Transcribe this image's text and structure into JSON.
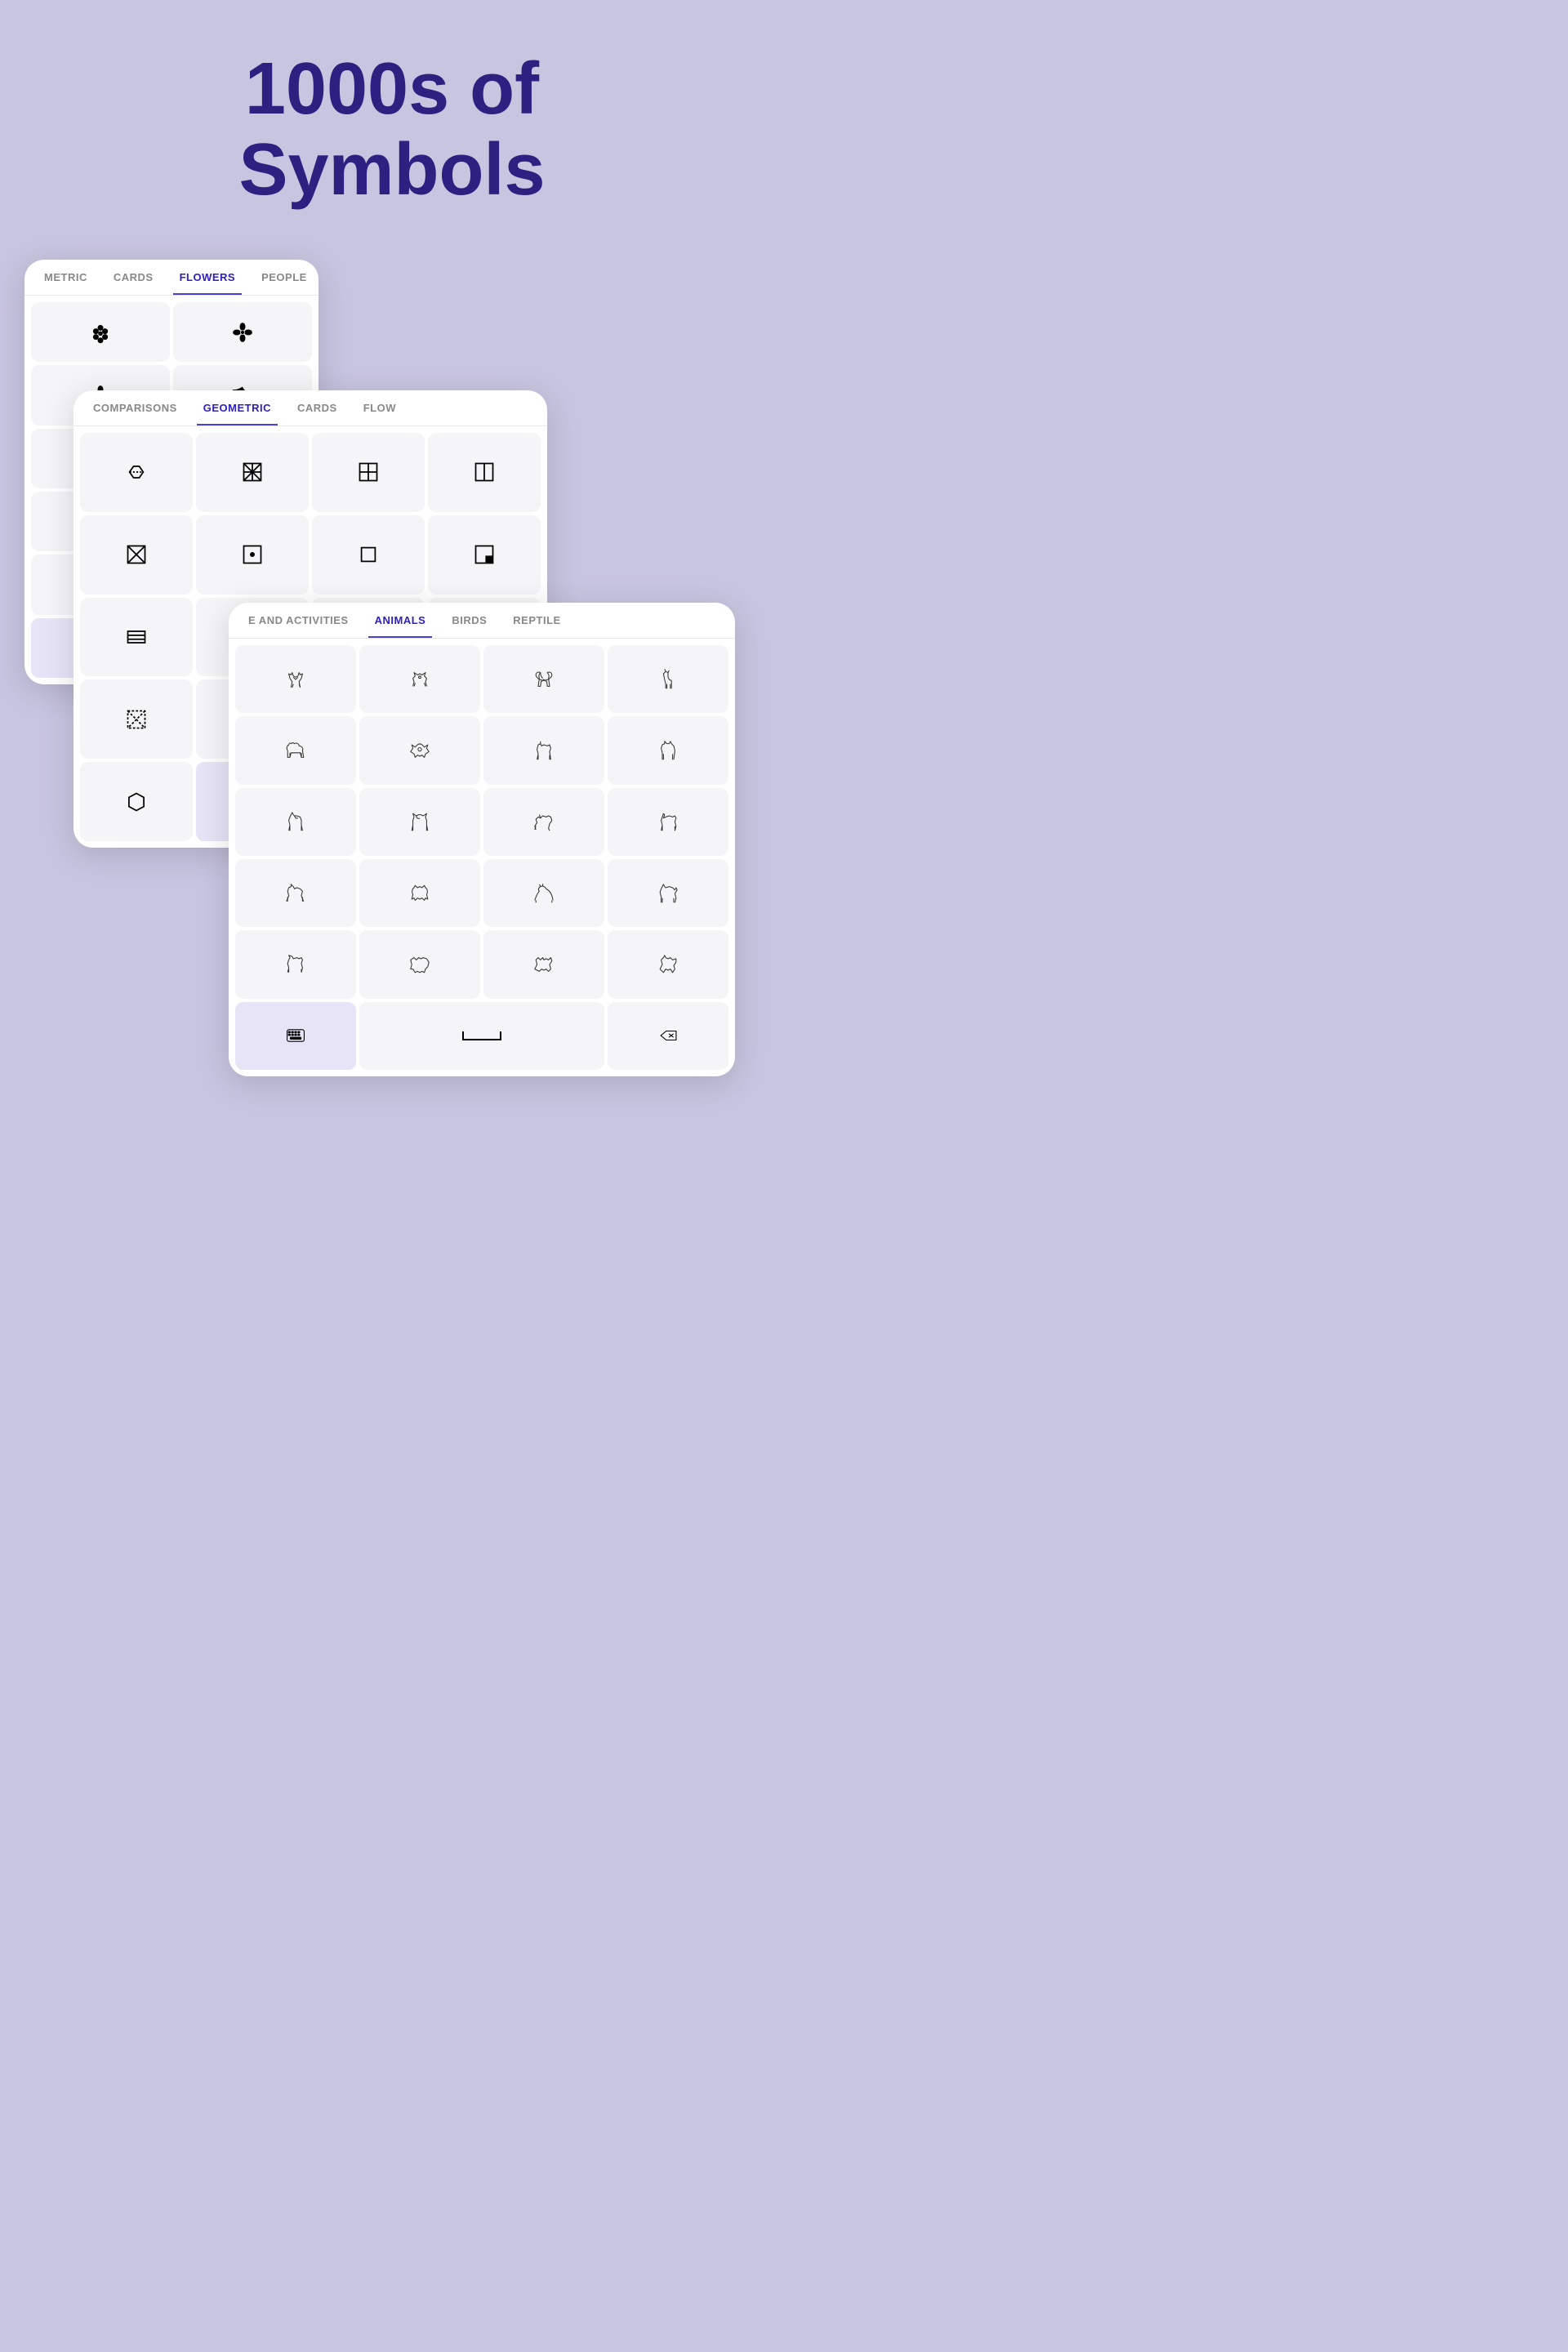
{
  "title": {
    "line1": "1000s of",
    "line2": "Symbols"
  },
  "panel1": {
    "tabs": [
      {
        "label": "METRIC",
        "active": false
      },
      {
        "label": "CARDS",
        "active": false
      },
      {
        "label": "FLOWERS",
        "active": true
      },
      {
        "label": "PEOPLE AND ACT",
        "active": false
      }
    ]
  },
  "panel2": {
    "tabs": [
      {
        "label": "COMPARISONS",
        "active": false
      },
      {
        "label": "GEOMETRIC",
        "active": true
      },
      {
        "label": "CARDS",
        "active": false
      },
      {
        "label": "FLOW",
        "active": false
      }
    ]
  },
  "panel3": {
    "tabs": [
      {
        "label": "E AND ACTIVITIES",
        "active": false
      },
      {
        "label": "ANIMALS",
        "active": true
      },
      {
        "label": "BIRDS",
        "active": false
      },
      {
        "label": "REPTILE",
        "active": false
      }
    ]
  }
}
